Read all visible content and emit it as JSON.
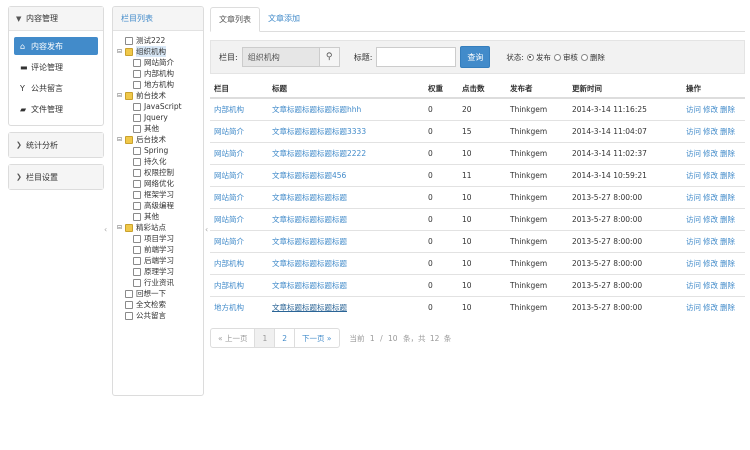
{
  "leftmenu": {
    "content_title": "内容管理",
    "items": [
      {
        "label": "内容发布",
        "icon": "home-icon"
      },
      {
        "label": "评论管理",
        "icon": "comment-icon"
      },
      {
        "label": "公共留言",
        "icon": "filter-icon"
      },
      {
        "label": "文件管理",
        "icon": "folder-open-icon"
      }
    ],
    "stats_title": "统计分析",
    "settings_title": "栏目设置"
  },
  "tree": {
    "title": "栏目列表",
    "nodes": [
      {
        "label": "测试222",
        "type": "file",
        "level": 1
      },
      {
        "label": "组织机构",
        "type": "folder",
        "level": 1,
        "expander": "⊟"
      },
      {
        "label": "网站简介",
        "type": "file",
        "level": 2
      },
      {
        "label": "内部机构",
        "type": "file",
        "level": 2
      },
      {
        "label": "地方机构",
        "type": "file",
        "level": 2
      },
      {
        "label": "前台技术",
        "type": "folder",
        "level": 1,
        "expander": "⊟"
      },
      {
        "label": "JavaScript",
        "type": "file",
        "level": 2
      },
      {
        "label": "Jquery",
        "type": "file",
        "level": 2
      },
      {
        "label": "其他",
        "type": "file",
        "level": 2
      },
      {
        "label": "后台技术",
        "type": "folder",
        "level": 1,
        "expander": "⊟"
      },
      {
        "label": "Spring",
        "type": "file",
        "level": 2
      },
      {
        "label": "持久化",
        "type": "file",
        "level": 2
      },
      {
        "label": "权限控制",
        "type": "file",
        "level": 2
      },
      {
        "label": "网络优化",
        "type": "file",
        "level": 2
      },
      {
        "label": "框架学习",
        "type": "file",
        "level": 2
      },
      {
        "label": "高级编程",
        "type": "file",
        "level": 2
      },
      {
        "label": "其他",
        "type": "file",
        "level": 2
      },
      {
        "label": "精彩站点",
        "type": "folder",
        "level": 1,
        "expander": "⊟"
      },
      {
        "label": "项目学习",
        "type": "file",
        "level": 2
      },
      {
        "label": "前端学习",
        "type": "file",
        "level": 2
      },
      {
        "label": "后端学习",
        "type": "file",
        "level": 2
      },
      {
        "label": "原理学习",
        "type": "file",
        "level": 2
      },
      {
        "label": "行业资讯",
        "type": "file",
        "level": 2
      },
      {
        "label": "回想一下",
        "type": "file",
        "level": 1
      },
      {
        "label": "全文检索",
        "type": "file",
        "level": 1
      },
      {
        "label": "公共留言",
        "type": "file",
        "level": 1
      }
    ]
  },
  "tabs": [
    {
      "label": "文章列表",
      "active": true
    },
    {
      "label": "文章添加",
      "active": false
    }
  ],
  "search": {
    "column_label": "栏目:",
    "column_value": "组织机构",
    "title_label": "标题:",
    "title_value": "",
    "query_button": "查询",
    "status_label": "状态:",
    "status_options": [
      {
        "label": "发布",
        "checked": true
      },
      {
        "label": "审核",
        "checked": false
      },
      {
        "label": "删除",
        "checked": false
      }
    ]
  },
  "table": {
    "headers": [
      "栏目",
      "标题",
      "权重",
      "点击数",
      "发布者",
      "更新时间",
      "操作"
    ],
    "rows": [
      {
        "column": "内部机构",
        "title": "文章标题标题标题标题hhh",
        "weight": "0",
        "clicks": "20",
        "author": "Thinkgem",
        "updated": "2014-3-14 11:16:25"
      },
      {
        "column": "网站简介",
        "title": "文章标题标题标题标题3333",
        "weight": "0",
        "clicks": "15",
        "author": "Thinkgem",
        "updated": "2014-3-14 11:04:07"
      },
      {
        "column": "网站简介",
        "title": "文章标题标题标题标题2222",
        "weight": "0",
        "clicks": "10",
        "author": "Thinkgem",
        "updated": "2014-3-14 11:02:37"
      },
      {
        "column": "网站简介",
        "title": "文章标题标题标题456",
        "weight": "0",
        "clicks": "11",
        "author": "Thinkgem",
        "updated": "2014-3-14 10:59:21"
      },
      {
        "column": "网站简介",
        "title": "文章标题标题标题标题",
        "weight": "0",
        "clicks": "10",
        "author": "Thinkgem",
        "updated": "2013-5-27 8:00:00"
      },
      {
        "column": "网站简介",
        "title": "文章标题标题标题标题",
        "weight": "0",
        "clicks": "10",
        "author": "Thinkgem",
        "updated": "2013-5-27 8:00:00"
      },
      {
        "column": "网站简介",
        "title": "文章标题标题标题标题",
        "weight": "0",
        "clicks": "10",
        "author": "Thinkgem",
        "updated": "2013-5-27 8:00:00"
      },
      {
        "column": "内部机构",
        "title": "文章标题标题标题标题",
        "weight": "0",
        "clicks": "10",
        "author": "Thinkgem",
        "updated": "2013-5-27 8:00:00"
      },
      {
        "column": "内部机构",
        "title": "文章标题标题标题标题",
        "weight": "0",
        "clicks": "10",
        "author": "Thinkgem",
        "updated": "2013-5-27 8:00:00"
      },
      {
        "column": "地方机构",
        "title": "文章标题标题标题标题",
        "weight": "0",
        "clicks": "10",
        "author": "Thinkgem",
        "updated": "2013-5-27 8:00:00"
      }
    ],
    "ops": [
      "访问",
      "修改",
      "删除"
    ]
  },
  "pager": {
    "prev": "« 上一页",
    "pages": [
      "1",
      "2"
    ],
    "next": "下一页 »",
    "info_prefix": "当前",
    "current": "1",
    "sep": "/",
    "total_pages": "10",
    "info_mid": "条，共",
    "total": "12",
    "info_suffix": "条"
  },
  "colors": {
    "accent": "#428bca",
    "folder": "#f0c84a"
  }
}
